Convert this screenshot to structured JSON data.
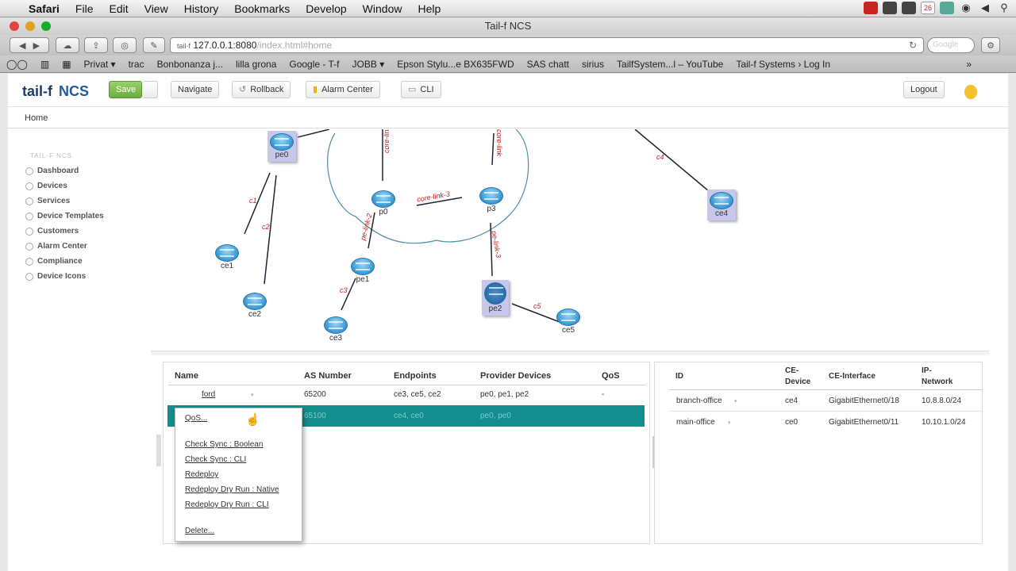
{
  "menubar": {
    "app": "Safari",
    "items": [
      "File",
      "Edit",
      "View",
      "History",
      "Bookmarks",
      "Develop",
      "Window",
      "Help"
    ],
    "calendar_day": "26"
  },
  "window": {
    "title": "Tail-f NCS"
  },
  "browser": {
    "url_host": "127.0.0.1:8080",
    "url_path": "/index.html#home",
    "bookmarks": [
      "Privat ▾",
      "trac",
      "Bonbonanza j...",
      "lilla grona",
      "Google - T-f",
      "JOBB ▾",
      "Epson Stylu...e BX635FWD",
      "SAS chatt",
      "sirius",
      "TailfSystem...l – YouTube",
      "Tail-f Systems › Log In"
    ]
  },
  "app": {
    "logo": "tail-f",
    "product": "NCS",
    "save_label": "Save",
    "navigate_label": "Navigate",
    "rollback_label": "Rollback",
    "alarm_center_label": "Alarm Center",
    "cli_label": "CLI",
    "logout_label": "Logout",
    "breadcrumb": "Home"
  },
  "sidebar": {
    "heading": "TAIL-F NCS",
    "items": [
      "Dashboard",
      "Devices",
      "Services",
      "Device Templates",
      "Customers",
      "Alarm Center",
      "Compliance",
      "Device Icons"
    ]
  },
  "topology": {
    "nodes": [
      "pe0",
      "p0",
      "p3",
      "ce4",
      "ce1",
      "ce2",
      "pe1",
      "ce3",
      "pe2",
      "ce5"
    ],
    "links": [
      "core-link",
      "core-link",
      "core-link-3",
      "pe-link-2",
      "pe-link-3",
      "c1",
      "c2",
      "c3",
      "c5",
      "c4"
    ]
  },
  "services_table": {
    "headers": [
      "Name",
      "AS Number",
      "Endpoints",
      "Provider Devices",
      "QoS"
    ],
    "rows": [
      {
        "name": "ford",
        "as": "65200",
        "endpoints": "ce3, ce5, ce2",
        "providers": "pe0, pe1, pe2",
        "qos": "-"
      },
      {
        "name": "",
        "as": "65100",
        "endpoints": "ce4, ce0",
        "providers": "pe0, pe0",
        "qos": ""
      }
    ]
  },
  "context_menu": {
    "items": [
      "QoS...",
      "Check Sync : Boolean",
      "Check Sync : CLI",
      "Redeploy",
      "Redeploy Dry Run : Native",
      "Redeploy Dry Run : CLI",
      "Delete..."
    ]
  },
  "endpoints_table": {
    "headers": [
      "ID",
      "CE-Device",
      "CE-Interface",
      "IP-Network"
    ],
    "rows": [
      {
        "id": "branch-office",
        "device": "ce4",
        "iface": "GigabitEthernet0/18",
        "net": "10.8.8.0/24"
      },
      {
        "id": "main-office",
        "device": "ce0",
        "iface": "GigabitEthernet0/11",
        "net": "10.10.1.0/24"
      }
    ]
  }
}
